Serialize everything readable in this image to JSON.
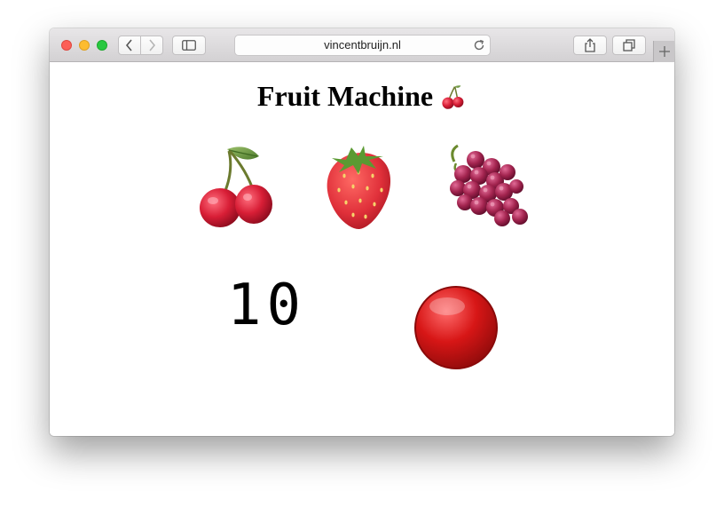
{
  "browser": {
    "url": "vincentbruijn.nl",
    "icons": {
      "back": "chevron-left-icon",
      "forward": "chevron-right-icon",
      "sidebar": "sidebar-icon",
      "reload": "reload-icon",
      "share": "share-icon",
      "tabs": "tabs-icon",
      "new_tab": "plus-icon"
    }
  },
  "game": {
    "title": "Fruit Machine",
    "title_icon": "cherries-icon",
    "reels": [
      {
        "fruit": "cherries"
      },
      {
        "fruit": "strawberry"
      },
      {
        "fruit": "grapes"
      }
    ],
    "score": "10",
    "spin_button_icon": "red-circle-icon"
  },
  "colors": {
    "close": "#fc5f57",
    "minimize": "#fdbc2e",
    "maximize": "#28c840",
    "cherry": "#d81e36",
    "strawberry": "#e0303a",
    "grape": "#a3244f",
    "spin_button": "#d71616"
  }
}
